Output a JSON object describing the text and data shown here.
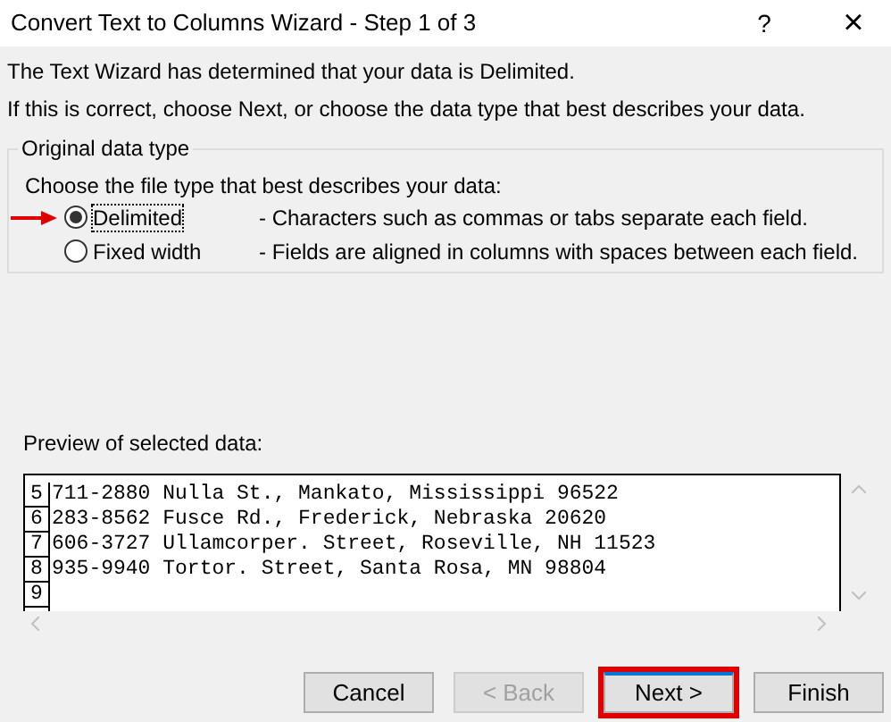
{
  "window": {
    "title": "Convert Text to Columns Wizard - Step 1 of 3",
    "help": "?",
    "close": "×"
  },
  "intro": [
    "The Text Wizard has determined that your data is Delimited.",
    "If this is correct, choose Next, or choose the data type that best describes your data."
  ],
  "group": {
    "title": "Original data type",
    "prompt": "Choose the file type that best describes your data:",
    "options": [
      {
        "label": "Delimited",
        "description": "- Characters such as commas or tabs separate each field.",
        "selected": true,
        "annotated": true
      },
      {
        "label": "Fixed width",
        "description": "- Fields are aligned in columns with spaces between each field.",
        "selected": false,
        "annotated": false
      }
    ]
  },
  "preview": {
    "label": "Preview of selected data:",
    "rows": [
      {
        "number": "5",
        "text": "711-2880 Nulla St., Mankato, Mississippi 96522"
      },
      {
        "number": "6",
        "text": "283-8562 Fusce Rd., Frederick, Nebraska 20620"
      },
      {
        "number": "7",
        "text": "606-3727 Ullamcorper. Street, Roseville, NH 11523"
      },
      {
        "number": "8",
        "text": "935-9940 Tortor. Street, Santa Rosa, MN 98804"
      },
      {
        "number": "9",
        "text": ""
      }
    ]
  },
  "buttons": [
    {
      "label": "Cancel",
      "disabled": false,
      "highlighted": false,
      "default": false
    },
    {
      "label": "< Back",
      "disabled": true,
      "highlighted": false,
      "default": false
    },
    {
      "label": "Next >",
      "disabled": false,
      "highlighted": true,
      "default": true
    },
    {
      "label": "Finish",
      "disabled": false,
      "highlighted": false,
      "default": false
    }
  ]
}
